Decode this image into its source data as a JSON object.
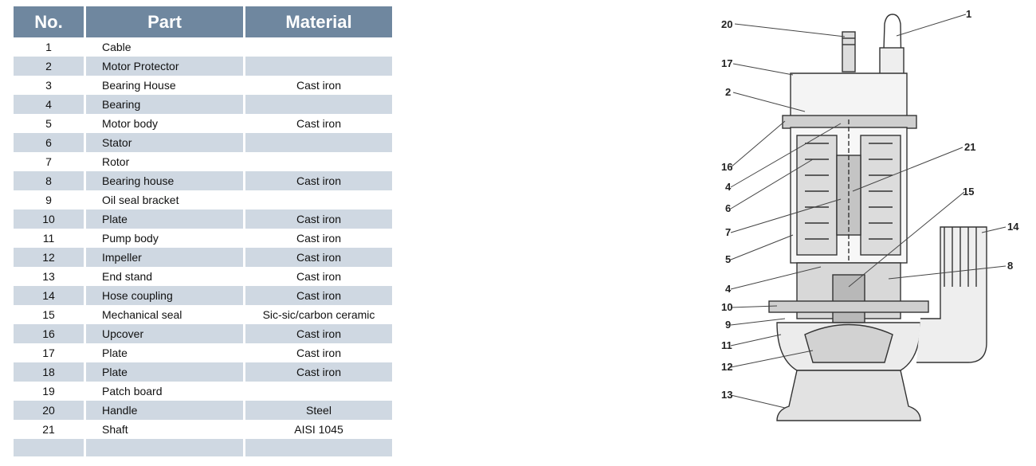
{
  "table": {
    "headers": {
      "no": "No.",
      "part": "Part",
      "material": "Material"
    },
    "rows": [
      {
        "no": "1",
        "part": "Cable",
        "material": ""
      },
      {
        "no": "2",
        "part": "Motor Protector",
        "material": ""
      },
      {
        "no": "3",
        "part": "Bearing House",
        "material": "Cast iron"
      },
      {
        "no": "4",
        "part": "Bearing",
        "material": ""
      },
      {
        "no": "5",
        "part": "Motor body",
        "material": "Cast iron"
      },
      {
        "no": "6",
        "part": "Stator",
        "material": ""
      },
      {
        "no": "7",
        "part": "Rotor",
        "material": ""
      },
      {
        "no": "8",
        "part": "Bearing house",
        "material": "Cast iron"
      },
      {
        "no": "9",
        "part": "Oil seal bracket",
        "material": ""
      },
      {
        "no": "10",
        "part": "Plate",
        "material": "Cast iron"
      },
      {
        "no": "11",
        "part": "Pump body",
        "material": "Cast iron"
      },
      {
        "no": "12",
        "part": "Impeller",
        "material": "Cast iron"
      },
      {
        "no": "13",
        "part": "End stand",
        "material": "Cast iron"
      },
      {
        "no": "14",
        "part": "Hose coupling",
        "material": "Cast iron"
      },
      {
        "no": "15",
        "part": "Mechanical seal",
        "material": "Sic-sic/carbon ceramic"
      },
      {
        "no": "16",
        "part": "Upcover",
        "material": "Cast iron"
      },
      {
        "no": "17",
        "part": "Plate",
        "material": "Cast iron"
      },
      {
        "no": "18",
        "part": "Plate",
        "material": "Cast iron"
      },
      {
        "no": "19",
        "part": "Patch board",
        "material": ""
      },
      {
        "no": "20",
        "part": "Handle",
        "material": "Steel"
      },
      {
        "no": "21",
        "part": "Shaft",
        "material": "AISI 1045"
      }
    ],
    "colors": {
      "header_bg": "#6f879f",
      "stripe_bg": "#cfd8e2",
      "header_text": "#ffffff"
    }
  },
  "diagram": {
    "callouts": [
      "20",
      "1",
      "17",
      "2",
      "16",
      "4",
      "21",
      "6",
      "15",
      "7",
      "14",
      "5",
      "8",
      "4",
      "10",
      "9",
      "11",
      "12",
      "13"
    ]
  }
}
